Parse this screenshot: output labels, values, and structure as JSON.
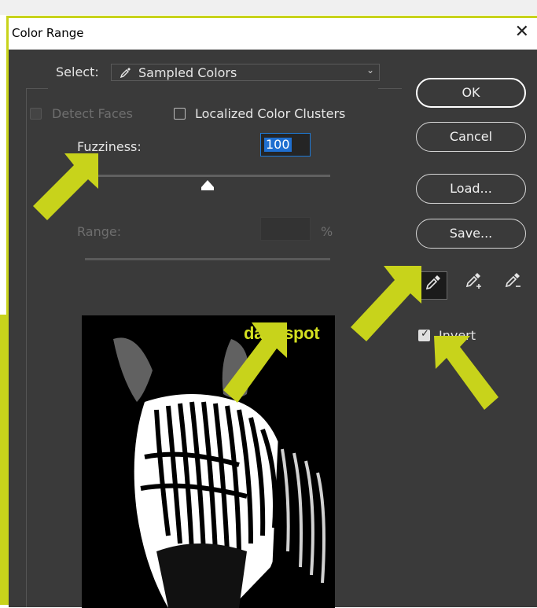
{
  "dialog": {
    "title": "Color Range",
    "close_icon": "close-icon"
  },
  "select": {
    "label": "Select:",
    "value": "Sampled Colors",
    "icon": "eyedropper-icon"
  },
  "options": {
    "detect_faces": {
      "label": "Detect Faces",
      "checked": false,
      "enabled": false
    },
    "localized_color_clusters": {
      "label": "Localized Color Clusters",
      "checked": false,
      "enabled": true
    }
  },
  "fuzziness": {
    "label": "Fuzziness:",
    "value": "100",
    "slider_fraction": 0.5
  },
  "range": {
    "label": "Range:",
    "value": "",
    "unit": "%",
    "enabled": false
  },
  "buttons": {
    "ok": "OK",
    "cancel": "Cancel",
    "load": "Load...",
    "save": "Save..."
  },
  "tools": [
    {
      "name": "eyedropper-icon",
      "active": true
    },
    {
      "name": "eyedropper-plus-icon",
      "active": false
    },
    {
      "name": "eyedropper-minus-icon",
      "active": false
    }
  ],
  "invert": {
    "label": "Invert",
    "checked": true
  },
  "annotation": {
    "text": "dark spot",
    "color": "#d4e020"
  },
  "colors": {
    "accent": "#c8d31b",
    "dialog_bg": "#3a3a3a",
    "selection_blue": "#1f6fd0"
  }
}
